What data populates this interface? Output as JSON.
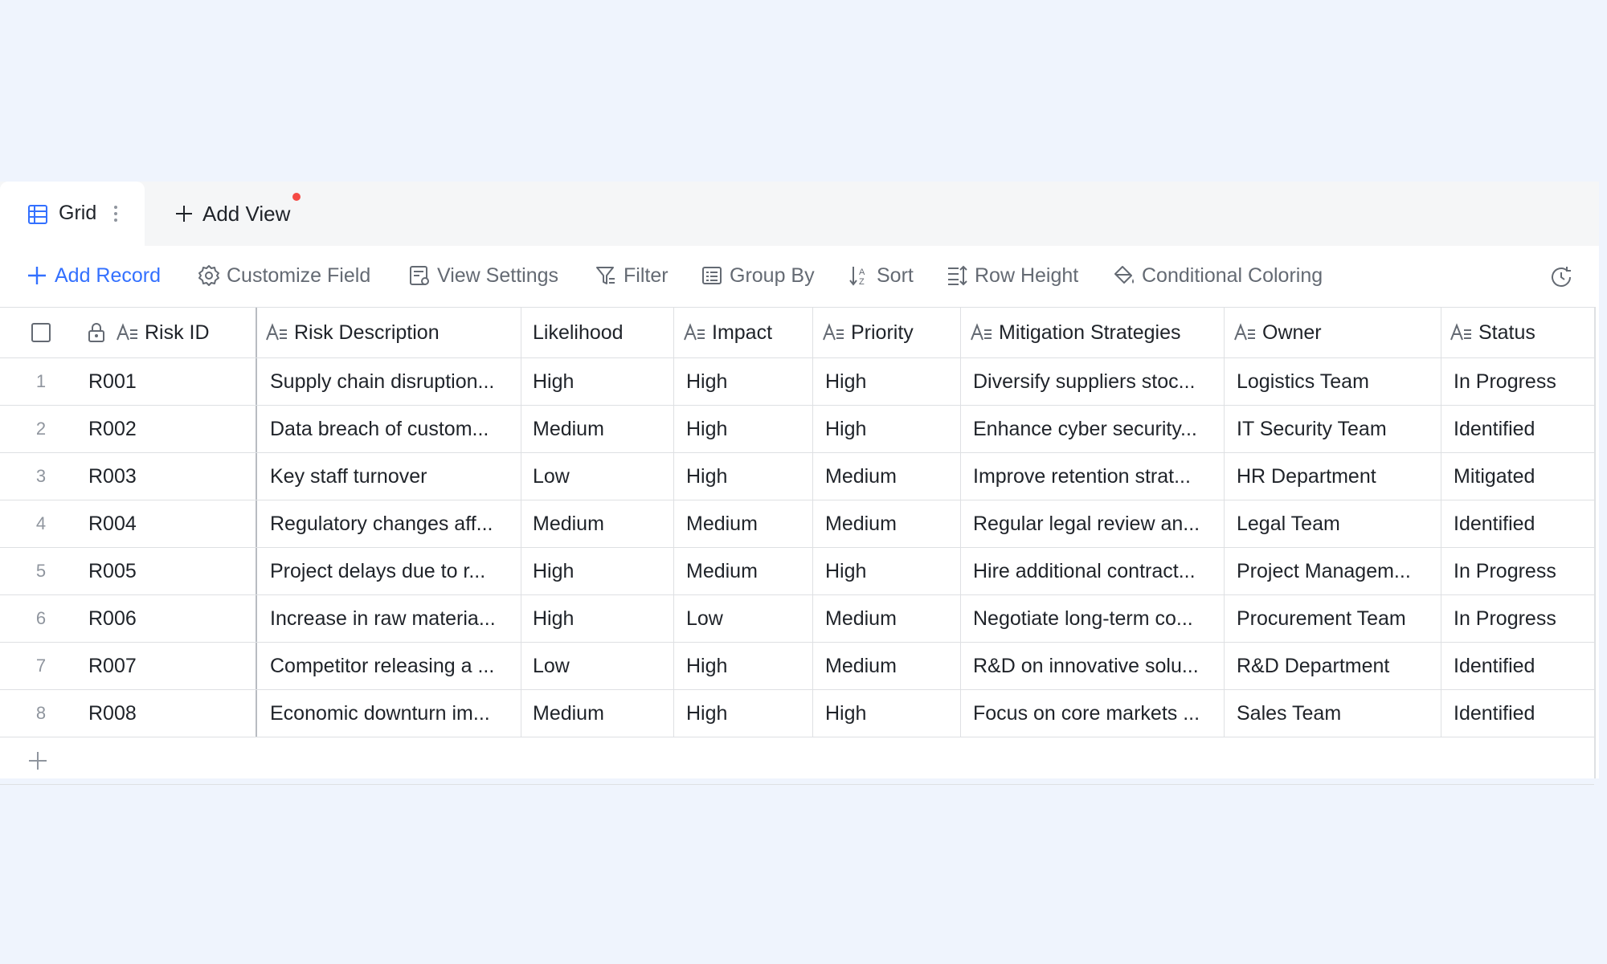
{
  "tabs": {
    "active_label": "Grid",
    "add_view_label": "Add View"
  },
  "toolbar": {
    "add_record": "Add Record",
    "customize_field": "Customize Field",
    "view_settings": "View Settings",
    "filter": "Filter",
    "group_by": "Group By",
    "sort": "Sort",
    "row_height": "Row Height",
    "conditional_coloring": "Conditional Coloring"
  },
  "columns": [
    "Risk ID",
    "Risk Description",
    "Likelihood",
    "Impact",
    "Priority",
    "Mitigation Strategies",
    "Owner",
    "Status"
  ],
  "rows": [
    {
      "num": "1",
      "cells": [
        "R001",
        "Supply chain disruption...",
        "High",
        "High",
        "High",
        "Diversify suppliers stoc...",
        "Logistics Team",
        "In Progress"
      ]
    },
    {
      "num": "2",
      "cells": [
        "R002",
        "Data breach of custom...",
        "Medium",
        "High",
        "High",
        "Enhance cyber security...",
        "IT Security Team",
        "Identified"
      ]
    },
    {
      "num": "3",
      "cells": [
        "R003",
        "Key staff turnover",
        "Low",
        "High",
        "Medium",
        "Improve retention strat...",
        "HR Department",
        "Mitigated"
      ]
    },
    {
      "num": "4",
      "cells": [
        "R004",
        "Regulatory changes aff...",
        "Medium",
        "Medium",
        "Medium",
        "Regular legal review an...",
        "Legal Team",
        "Identified"
      ]
    },
    {
      "num": "5",
      "cells": [
        "R005",
        "Project delays due to r...",
        "High",
        "Medium",
        "High",
        "Hire additional contract...",
        "Project Managem...",
        "In Progress"
      ]
    },
    {
      "num": "6",
      "cells": [
        "R006",
        "Increase in raw materia...",
        "High",
        "Low",
        "Medium",
        "Negotiate long-term co...",
        "Procurement Team",
        "In Progress"
      ]
    },
    {
      "num": "7",
      "cells": [
        "R007",
        "Competitor releasing a ...",
        "Low",
        "High",
        "Medium",
        "R&D on innovative solu...",
        "R&D Department",
        "Identified"
      ]
    },
    {
      "num": "8",
      "cells": [
        "R008",
        "Economic downturn im...",
        "Medium",
        "High",
        "High",
        "Focus on core markets ...",
        "Sales Team",
        "Identified"
      ]
    }
  ],
  "colors": {
    "accent": "#3370ff",
    "background": "#eff4fd",
    "notification_dot": "#f54a45"
  }
}
